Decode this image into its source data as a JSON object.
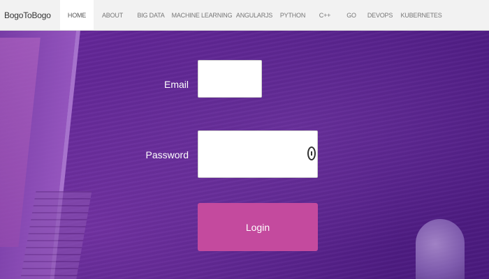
{
  "navbar": {
    "brand": "BogoToBogo",
    "items": [
      {
        "label": "HOME",
        "active": true
      },
      {
        "label": "ABOUT",
        "active": false
      },
      {
        "label": "BIG DATA",
        "active": false
      },
      {
        "label": "MACHINE LEARNING",
        "active": false
      },
      {
        "label": "ANGULARJS",
        "active": false
      },
      {
        "label": "PYTHON",
        "active": false
      },
      {
        "label": "C++",
        "active": false
      },
      {
        "label": "GO",
        "active": false
      },
      {
        "label": "DEVOPS",
        "active": false
      },
      {
        "label": "KUBERNETES",
        "active": false
      }
    ]
  },
  "form": {
    "email_label": "Email",
    "email_value": "",
    "password_label": "Password",
    "password_value": "",
    "login_label": "Login"
  },
  "icons": {
    "password_toggle": "eye-icon"
  }
}
